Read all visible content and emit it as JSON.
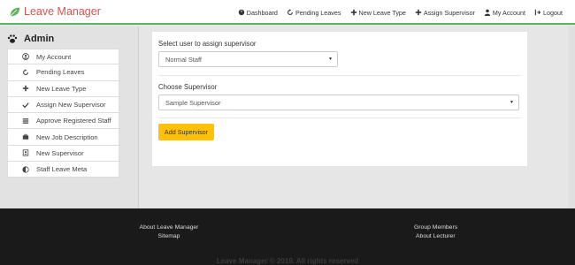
{
  "brand": {
    "name": "Leave Manager"
  },
  "nav": [
    {
      "label": "Dashboard",
      "icon": "dashboard-icon"
    },
    {
      "label": "Pending Leaves",
      "icon": "refresh-icon"
    },
    {
      "label": "New Leave Type",
      "icon": "plus-icon"
    },
    {
      "label": "Assign Supervisor",
      "icon": "plus-icon"
    },
    {
      "label": "My Account",
      "icon": "user-icon"
    },
    {
      "label": "Logout",
      "icon": "logout-icon"
    }
  ],
  "sidebar": {
    "title": "Admin",
    "items": [
      {
        "label": "My Account",
        "icon": "user-circle-icon"
      },
      {
        "label": "Pending Leaves",
        "icon": "refresh-icon"
      },
      {
        "label": "New Leave Type",
        "icon": "plus-icon"
      },
      {
        "label": "Assign New Supervisor",
        "icon": "check-icon"
      },
      {
        "label": "Approve Registered Staff",
        "icon": "list-icon"
      },
      {
        "label": "New Job Description",
        "icon": "briefcase-icon"
      },
      {
        "label": "New Supervisor",
        "icon": "id-card-icon"
      },
      {
        "label": "Staff Leave Meta",
        "icon": "half-circle-icon"
      }
    ]
  },
  "form": {
    "user_label": "Select user to assign supervisor",
    "user_value": "Normal Staff",
    "supervisor_label": "Choose Supervisor",
    "supervisor_value": "Sample Supervisor",
    "submit_label": "Add Supervisor"
  },
  "footer": {
    "about": "About Leave Manager",
    "sitemap": "Sitemap",
    "group": "Group Members",
    "lecturer": "About Lecturer",
    "copyright": "Leave Manager © 2019. All rights reserved"
  },
  "colors": {
    "brand": "#d9534f",
    "leaf": "#5fb35f",
    "button": "#ffc107",
    "footer": "#1a1a1a"
  }
}
